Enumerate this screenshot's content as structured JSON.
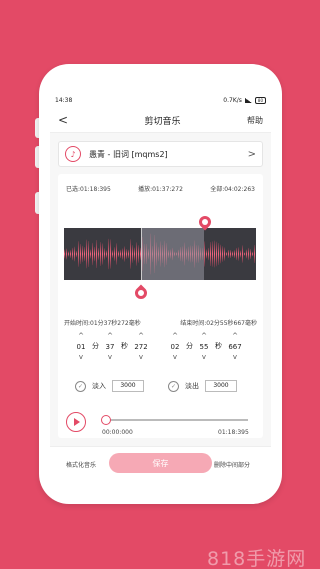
{
  "status": {
    "time": "14:38",
    "speed": "0.7K/s",
    "battery": "80"
  },
  "nav": {
    "back_glyph": "<",
    "title": "剪切音乐",
    "help": "帮助"
  },
  "song": {
    "icon": "music-note-icon",
    "name": "愚青 - 旧词 [mqms2]",
    "chevron": ">"
  },
  "times": {
    "selected": "已选:01:18:395",
    "playing": "播放:01:37:272",
    "total": "全部:04:02:263"
  },
  "cut": {
    "start_label": "开始时间:01分37秒272毫秒",
    "end_label": "结束时间:02分55秒667毫秒",
    "start": {
      "min": "01",
      "sec": "37",
      "ms": "272"
    },
    "end": {
      "min": "02",
      "sec": "55",
      "ms": "667"
    },
    "unit_min": "分",
    "unit_sec": "秒",
    "up": "^",
    "down": "v"
  },
  "fade": {
    "in_label": "淡入",
    "in_value": "3000",
    "out_label": "淡出",
    "out_value": "3000",
    "check": "✓"
  },
  "player": {
    "current": "00:00:000",
    "duration": "01:18:395",
    "progress": 0.0
  },
  "footer": {
    "format_label": "格式化音乐",
    "save_label": "保存",
    "delete_middle_label": "删除中间部分"
  },
  "watermark": "818手游网",
  "colors": {
    "accent": "#e34a66",
    "save_button": "#f6a9b5",
    "wave_bg": "#3a3a40"
  }
}
